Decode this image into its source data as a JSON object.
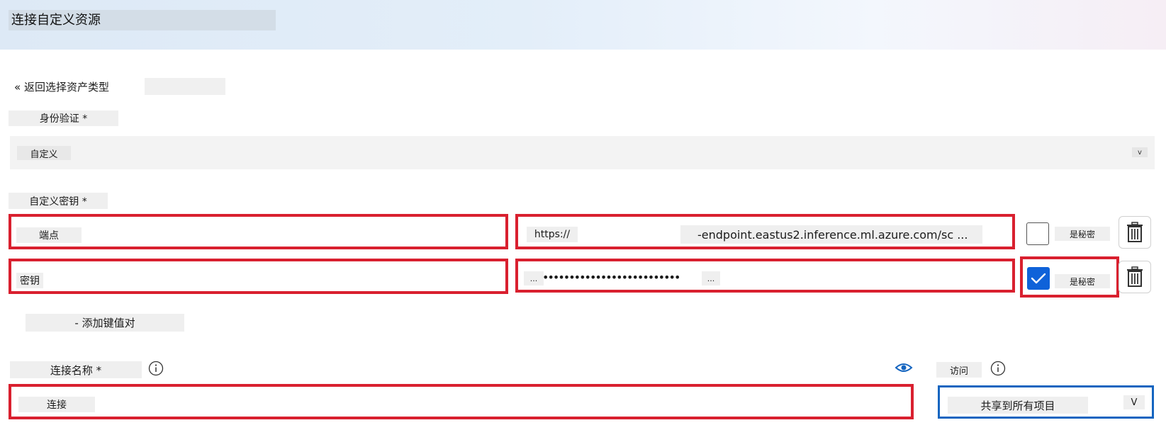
{
  "header": {
    "title": "连接自定义资源"
  },
  "back_link": {
    "label": "« 返回选择资产类型"
  },
  "auth": {
    "label": "身份验证 *",
    "selected": "自定义",
    "chevron": "v"
  },
  "custom_keys": {
    "label": "自定义密钥 *",
    "rows": [
      {
        "key": "端点",
        "value_prefix": "https://",
        "value_suffix": "-endpoint.eastus2.inference.ml.azure.com/sc ...",
        "secret_label": "是秘密",
        "is_secret": false
      },
      {
        "key": "密钥",
        "value_prefix": "...",
        "value_masked": "••••••••••••••••••••••••••",
        "value_more": "...",
        "secret_label": "是秘密",
        "is_secret": true
      }
    ],
    "add_pair": "- 添加键值对"
  },
  "connection_name": {
    "label": "连接名称 *",
    "value": "连接"
  },
  "access": {
    "label": "访问",
    "value": "共享到所有项目",
    "chevron": "V"
  },
  "colors": {
    "highlight_red": "#d9202f",
    "accent_blue": "#1565c0",
    "checkbox_blue": "#0f62d9"
  },
  "icons": [
    "info-icon",
    "eye-icon",
    "trash-icon",
    "checkmark-icon",
    "chevron-down-icon"
  ]
}
